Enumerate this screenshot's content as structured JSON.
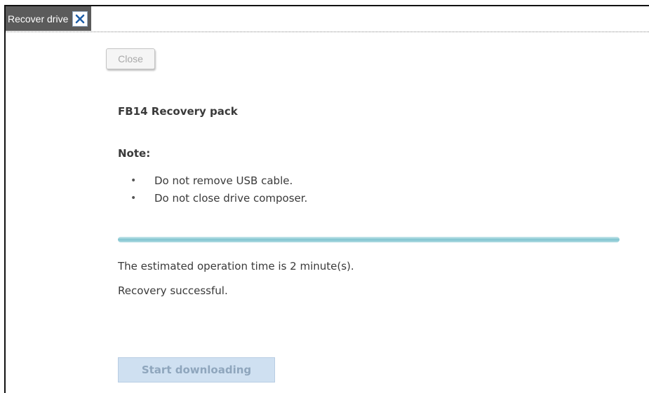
{
  "tab": {
    "label": "Recover drive",
    "close_icon": "close-x-icon"
  },
  "toolbar": {
    "close_label": "Close"
  },
  "content": {
    "title": "FB14 Recovery pack",
    "note_label": "Note:",
    "notes": [
      "Do not remove USB cable.",
      "Do not close drive composer."
    ],
    "progress_percent": 100,
    "estimate_text": "The estimated operation time is 2 minute(s).",
    "status_text": "Recovery successful.",
    "start_button_label": "Start downloading"
  },
  "colors": {
    "tab_bg": "#5b5b5b",
    "close_x": "#1f5fa8",
    "progress": "#7fc4cf",
    "disabled_button_bg": "#cfe0f1"
  }
}
